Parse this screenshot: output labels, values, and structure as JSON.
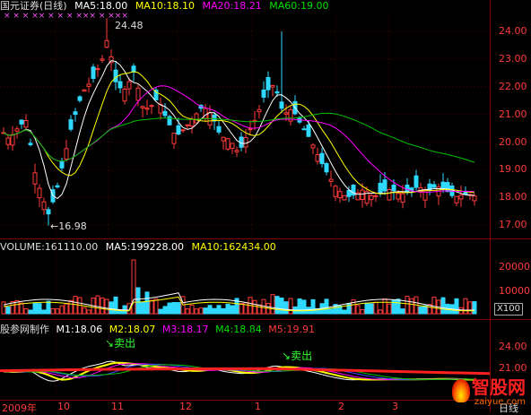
{
  "price_header": {
    "stock": "国元证券(日线)",
    "ma5": "MA5:18.00",
    "ma10": "MA10:18.10",
    "ma20": "MA20:18.21",
    "ma60": "MA60:19.00"
  },
  "price_axis": [
    "24.00",
    "23.00",
    "22.00",
    "21.00",
    "20.00",
    "19.00",
    "18.00",
    "17.00"
  ],
  "price_annotations": {
    "high": "24.48",
    "low": "←16.98"
  },
  "volume_header": {
    "volume": "VOLUME:161110.00",
    "ma5": "MA5:199228.00",
    "ma10": "MA10:162434.00"
  },
  "volume_axis": [
    "20000",
    "15000",
    "10000"
  ],
  "volume_unit": "X100",
  "indicator_header": {
    "name": "股参网制作",
    "m1": "M1:18.06",
    "m2": "M2:18.07",
    "m3": "M3:18.17",
    "m4": "M4:18.84",
    "m5": "M5:19.91"
  },
  "indicator_axis": [
    "24.00",
    "21.00"
  ],
  "signals": [
    "卖出",
    "卖出"
  ],
  "time_axis": [
    "2009年",
    "10",
    "11",
    "12",
    "1",
    "2",
    "3",
    "日线"
  ],
  "watermark": {
    "brand": "智股网",
    "url": "zaiyue.com"
  },
  "colors": {
    "up": "#ff3a3a",
    "down": "#2fd8ff",
    "ma5": "#ffffff",
    "ma10": "#ffff00",
    "ma20": "#ff00ff",
    "ma60": "#00c000",
    "grid": "#800000",
    "axis": "#ff3b3b"
  },
  "chart_data": {
    "type": "candlestick",
    "price_range": [
      16.8,
      24.6
    ],
    "series": [
      {
        "name": "MA5",
        "current": 18.0
      },
      {
        "name": "MA10",
        "current": 18.1
      },
      {
        "name": "MA20",
        "current": 18.21
      },
      {
        "name": "MA60",
        "current": 19.0
      }
    ],
    "high": 24.48,
    "low": 16.98,
    "volume": {
      "current": 161110,
      "ma5": 199228,
      "ma10": 162434,
      "unit": "X100"
    }
  }
}
